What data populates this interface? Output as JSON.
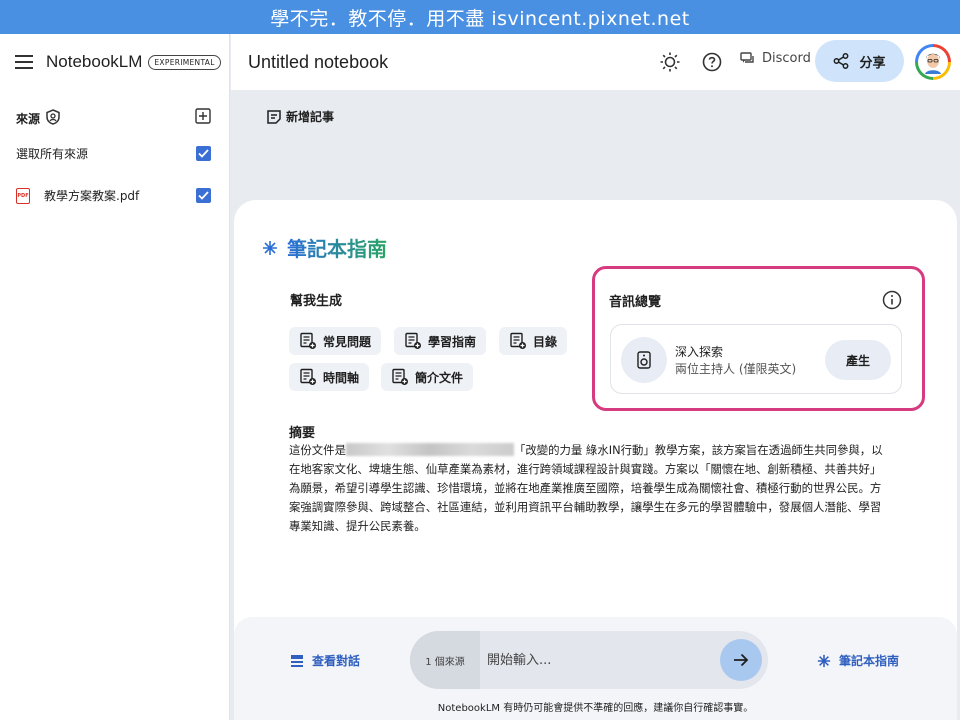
{
  "watermark": "學不完．教不停．用不盡 isvincent.pixnet.net",
  "brand": {
    "name": "NotebookLM",
    "badge": "EXPERIMENTAL"
  },
  "header": {
    "title": "Untitled notebook",
    "discord_label": "Discord",
    "share_label": "分享"
  },
  "sidebar": {
    "sources_title": "來源",
    "select_all_label": "選取所有來源",
    "items": [
      {
        "label": "教學方案教案.pdf",
        "type_badge": "PDF",
        "checked": true
      }
    ]
  },
  "notes": {
    "add_note_label": "新增記事"
  },
  "guide": {
    "title": "筆記本指南",
    "help_generate_label": "幫我生成",
    "chips": [
      "常見問題",
      "學習指南",
      "目錄",
      "時間軸",
      "簡介文件"
    ],
    "audio": {
      "title": "音訊總覽",
      "card_title": "深入探索",
      "card_subtitle": "兩位主持人 (僅限英文)",
      "generate_label": "產生"
    },
    "summary_heading": "摘要",
    "summary_prefix": "這份文件是",
    "summary_body": "「改變的力量 綠水IN行動」教學方案，該方案旨在透過師生共同參與，以在地客家文化、埤塘生態、仙草產業為素材，進行跨領域課程設計與實踐。方案以「關懷在地、創新積極、共善共好」為願景，希望引導學生認識、珍惜環境，並將在地產業推廣至國際，培養學生成為關懷社會、積極行動的世界公民。方案強調實際參與、跨域整合、社區連結，並利用資訊平台輔助教學，讓學生在多元的學習體驗中，發展個人潛能、學習專業知識、提升公民素養。"
  },
  "chat": {
    "view_chat_label": "查看對話",
    "source_count": "1 個來源",
    "placeholder": "開始輸入...",
    "guide_button_label": "筆記本指南",
    "disclaimer": "NotebookLM 有時仍可能會提供不準確的回應，建議你自行確認事實。"
  },
  "colors": {
    "accent": "#2f5fbf",
    "share_bg": "#cfe4fb",
    "highlight_border": "#d63a7f",
    "checkbox": "#3b6fd4"
  }
}
